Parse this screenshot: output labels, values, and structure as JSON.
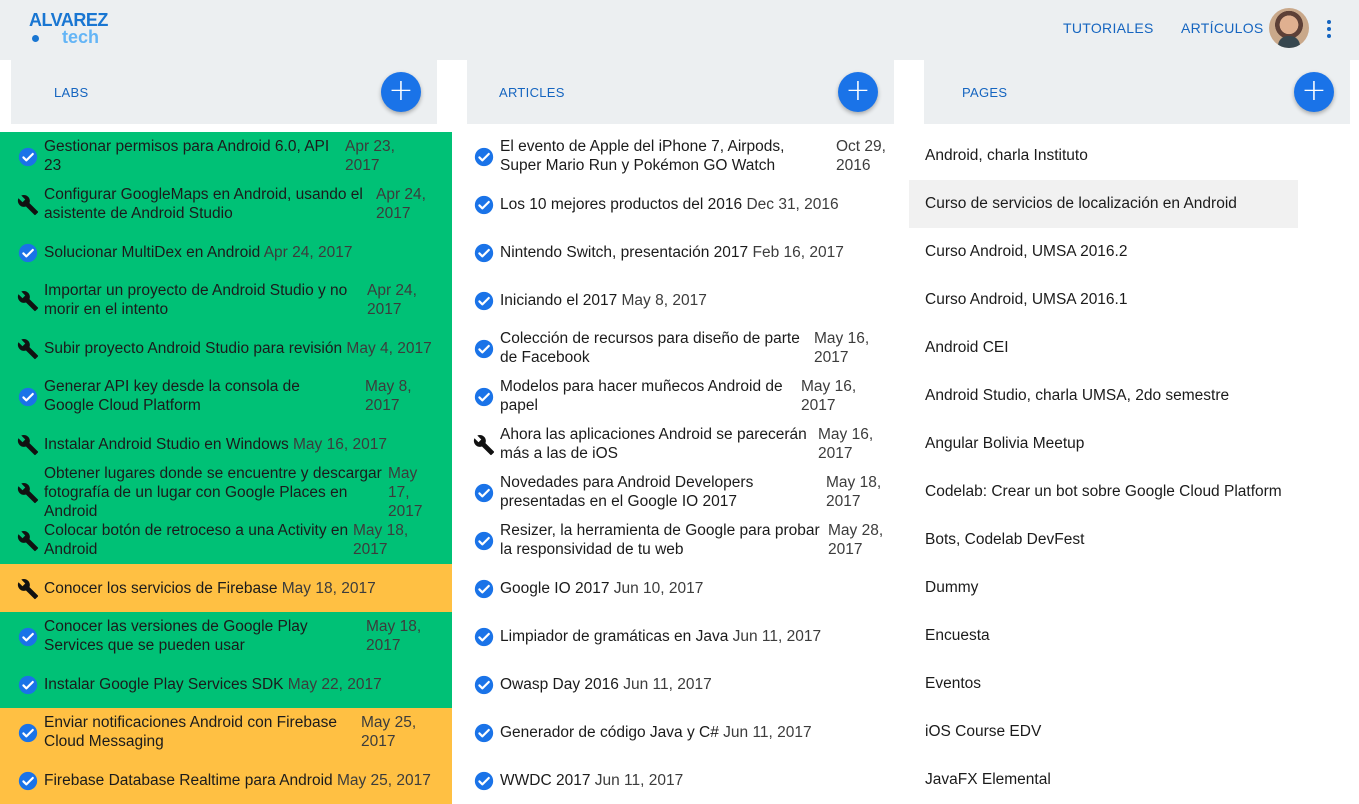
{
  "brand": {
    "line1": "ALVAREZ",
    "line2": "tech",
    "primary": "#1976d2",
    "secondary": "#64b5f6"
  },
  "nav": {
    "tutorials": "TUTORIALES",
    "articles": "ARTÍCULOS",
    "more_icon": "more-vert-icon"
  },
  "colors": {
    "lab_done": "#00c176",
    "lab_progress": "#ffc043",
    "accent": "#1a73e8",
    "header_bg": "#eceff1"
  },
  "labs": {
    "title": "LABS",
    "add_label": "+",
    "items": [
      {
        "title": "Gestionar permisos para Android 6.0, API 23",
        "date": "Apr 23, 2017",
        "status": "done",
        "icon": "check-circle-icon"
      },
      {
        "title": "Configurar GoogleMaps en Android, usando el asistente de Android Studio",
        "date": "Apr 24, 2017",
        "status": "done",
        "icon": "wrench-icon"
      },
      {
        "title": "Solucionar MultiDex en Android",
        "date": "Apr 24, 2017",
        "status": "done",
        "icon": "check-circle-icon"
      },
      {
        "title": "Importar un proyecto de Android Studio y no morir en el intento",
        "date": "Apr 24, 2017",
        "status": "done",
        "icon": "wrench-icon"
      },
      {
        "title": "Subir proyecto Android Studio para revisión",
        "date": "May 4, 2017",
        "status": "done",
        "icon": "wrench-icon"
      },
      {
        "title": "Generar API key desde la consola de Google Cloud Platform",
        "date": "May 8, 2017",
        "status": "done",
        "icon": "check-circle-icon"
      },
      {
        "title": "Instalar Android Studio en Windows",
        "date": "May 16, 2017",
        "status": "done",
        "icon": "wrench-icon"
      },
      {
        "title": "Obtener lugares donde se encuentre y descargar fotografía de un lugar con Google Places en Android",
        "date": "May 17, 2017",
        "status": "done",
        "icon": "wrench-icon"
      },
      {
        "title": "Colocar botón de retroceso a una Activity en Android",
        "date": "May 18, 2017",
        "status": "done",
        "icon": "wrench-icon"
      },
      {
        "title": "Conocer los servicios de Firebase",
        "date": "May 18, 2017",
        "status": "progress",
        "icon": "wrench-icon"
      },
      {
        "title": "Conocer las versiones de Google Play Services que se pueden usar",
        "date": "May 18, 2017",
        "status": "done",
        "icon": "check-circle-icon"
      },
      {
        "title": "Instalar Google Play Services SDK",
        "date": "May 22, 2017",
        "status": "done",
        "icon": "check-circle-icon"
      },
      {
        "title": "Enviar notificaciones Android con Firebase Cloud Messaging",
        "date": "May 25, 2017",
        "status": "progress",
        "icon": "check-circle-icon"
      },
      {
        "title": "Firebase Database Realtime para Android",
        "date": "May 25, 2017",
        "status": "progress",
        "icon": "check-circle-icon"
      }
    ]
  },
  "articles": {
    "title": "ARTICLES",
    "add_label": "+",
    "items": [
      {
        "title": "El evento de Apple del iPhone 7, Airpods, Super Mario Run y Pokémon GO Watch",
        "date": "Oct 29, 2016",
        "icon": "check-circle-icon"
      },
      {
        "title": "Los 10 mejores productos del 2016",
        "date": "Dec 31, 2016",
        "icon": "check-circle-icon"
      },
      {
        "title": "Nintendo Switch, presentación 2017",
        "date": "Feb 16, 2017",
        "icon": "check-circle-icon"
      },
      {
        "title": "Iniciando el 2017",
        "date": "May 8, 2017",
        "icon": "check-circle-icon"
      },
      {
        "title": "Colección de recursos para diseño de parte de Facebook",
        "date": "May 16, 2017",
        "icon": "check-circle-icon"
      },
      {
        "title": "Modelos para hacer muñecos Android de papel",
        "date": "May 16, 2017",
        "icon": "check-circle-icon"
      },
      {
        "title": "Ahora las aplicaciones Android se parecerán más a las de iOS",
        "date": "May 16, 2017",
        "icon": "wrench-icon"
      },
      {
        "title": "Novedades para Android Developers presentadas en el Google IO 2017",
        "date": "May 18, 2017",
        "icon": "check-circle-icon"
      },
      {
        "title": "Resizer, la herramienta de Google para probar la responsividad de tu web",
        "date": "May 28, 2017",
        "icon": "check-circle-icon"
      },
      {
        "title": "Google IO 2017",
        "date": "Jun 10, 2017",
        "icon": "check-circle-icon"
      },
      {
        "title": "Limpiador de gramáticas en Java",
        "date": "Jun 11, 2017",
        "icon": "check-circle-icon"
      },
      {
        "title": "Owasp Day 2016",
        "date": "Jun 11, 2017",
        "icon": "check-circle-icon"
      },
      {
        "title": "Generador de código Java y C#",
        "date": "Jun 11, 2017",
        "icon": "check-circle-icon"
      },
      {
        "title": "WWDC 2017",
        "date": "Jun 11, 2017",
        "icon": "check-circle-icon"
      }
    ]
  },
  "pages": {
    "title": "PAGES",
    "add_label": "+",
    "items": [
      "Android, charla Instituto",
      "Curso de servicios de localización en Android",
      "Curso Android, UMSA 2016.2",
      "Curso Android, UMSA 2016.1",
      "Android CEI",
      "Android Studio, charla UMSA, 2do semestre",
      "Angular Bolivia Meetup",
      "Codelab: Crear un bot sobre Google Cloud Platform",
      "Bots, Codelab DevFest",
      "Dummy",
      "Encuesta",
      "Eventos",
      "iOS Course EDV",
      "JavaFX Elemental"
    ]
  }
}
